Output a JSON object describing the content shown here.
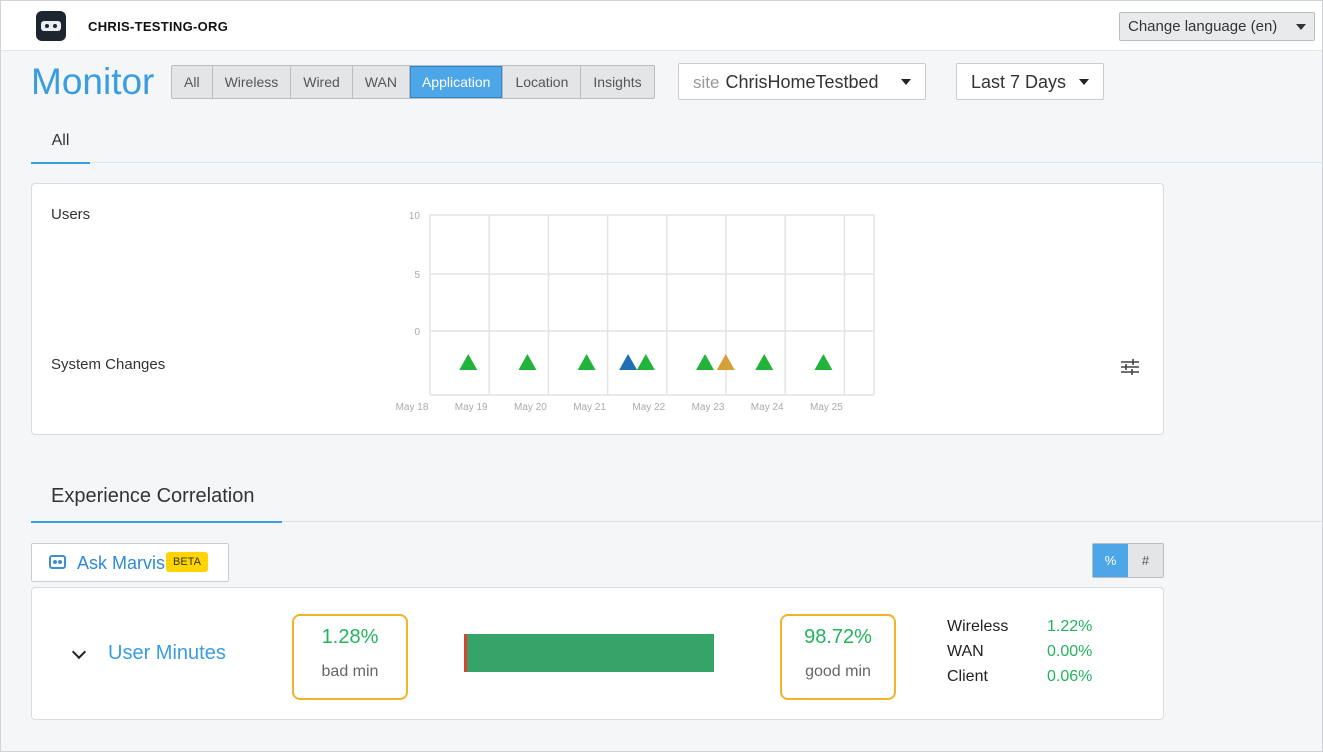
{
  "header": {
    "org_name": "CHRIS-TESTING-ORG",
    "language_label": "Change language (en)"
  },
  "page": {
    "title": "Monitor"
  },
  "tabs": [
    {
      "label": "All",
      "active": false
    },
    {
      "label": "Wireless",
      "active": false
    },
    {
      "label": "Wired",
      "active": false
    },
    {
      "label": "WAN",
      "active": false
    },
    {
      "label": "Application",
      "active": true
    },
    {
      "label": "Location",
      "active": false
    },
    {
      "label": "Insights",
      "active": false
    }
  ],
  "site_selector": {
    "prefix": "site",
    "value": "ChrisHomeTestbed"
  },
  "period_selector": {
    "value": "Last 7 Days"
  },
  "subtab": {
    "label": "All"
  },
  "chart_panel": {
    "users_label": "Users",
    "system_changes_label": "System Changes"
  },
  "chart_data": {
    "type": "scatter",
    "y_ticks": [
      "10",
      "5",
      "0"
    ],
    "ylim": [
      0,
      10
    ],
    "x_ticks": [
      "May 18",
      "May 19",
      "May 20",
      "May 21",
      "May 22",
      "May 23",
      "May 24",
      "May 25"
    ],
    "events": [
      {
        "day": 18.95,
        "color": "#22b33a"
      },
      {
        "day": 19.95,
        "color": "#22b33a"
      },
      {
        "day": 20.95,
        "color": "#22b33a"
      },
      {
        "day": 21.65,
        "color": "#1f6fb5"
      },
      {
        "day": 21.95,
        "color": "#22b33a"
      },
      {
        "day": 22.95,
        "color": "#22b33a"
      },
      {
        "day": 23.3,
        "color": "#d4a03a"
      },
      {
        "day": 23.95,
        "color": "#22b33a"
      },
      {
        "day": 24.95,
        "color": "#22b33a"
      }
    ]
  },
  "experience": {
    "title": "Experience Correlation"
  },
  "marvis": {
    "label": "Ask Marvis",
    "badge": "BETA"
  },
  "unit_toggle": {
    "percent": "%",
    "count": "#"
  },
  "metric": {
    "name": "User Minutes",
    "bad_pct": "1.28%",
    "bad_label": "bad min",
    "good_pct": "98.72%",
    "good_label": "good min",
    "bad_fraction": 0.0128,
    "good_color": "#36a469",
    "bad_color": "#e0402f",
    "breakdown": [
      {
        "name": "Wireless",
        "value": "1.22%"
      },
      {
        "name": "WAN",
        "value": "0.00%"
      },
      {
        "name": "Client",
        "value": "0.06%"
      }
    ]
  }
}
